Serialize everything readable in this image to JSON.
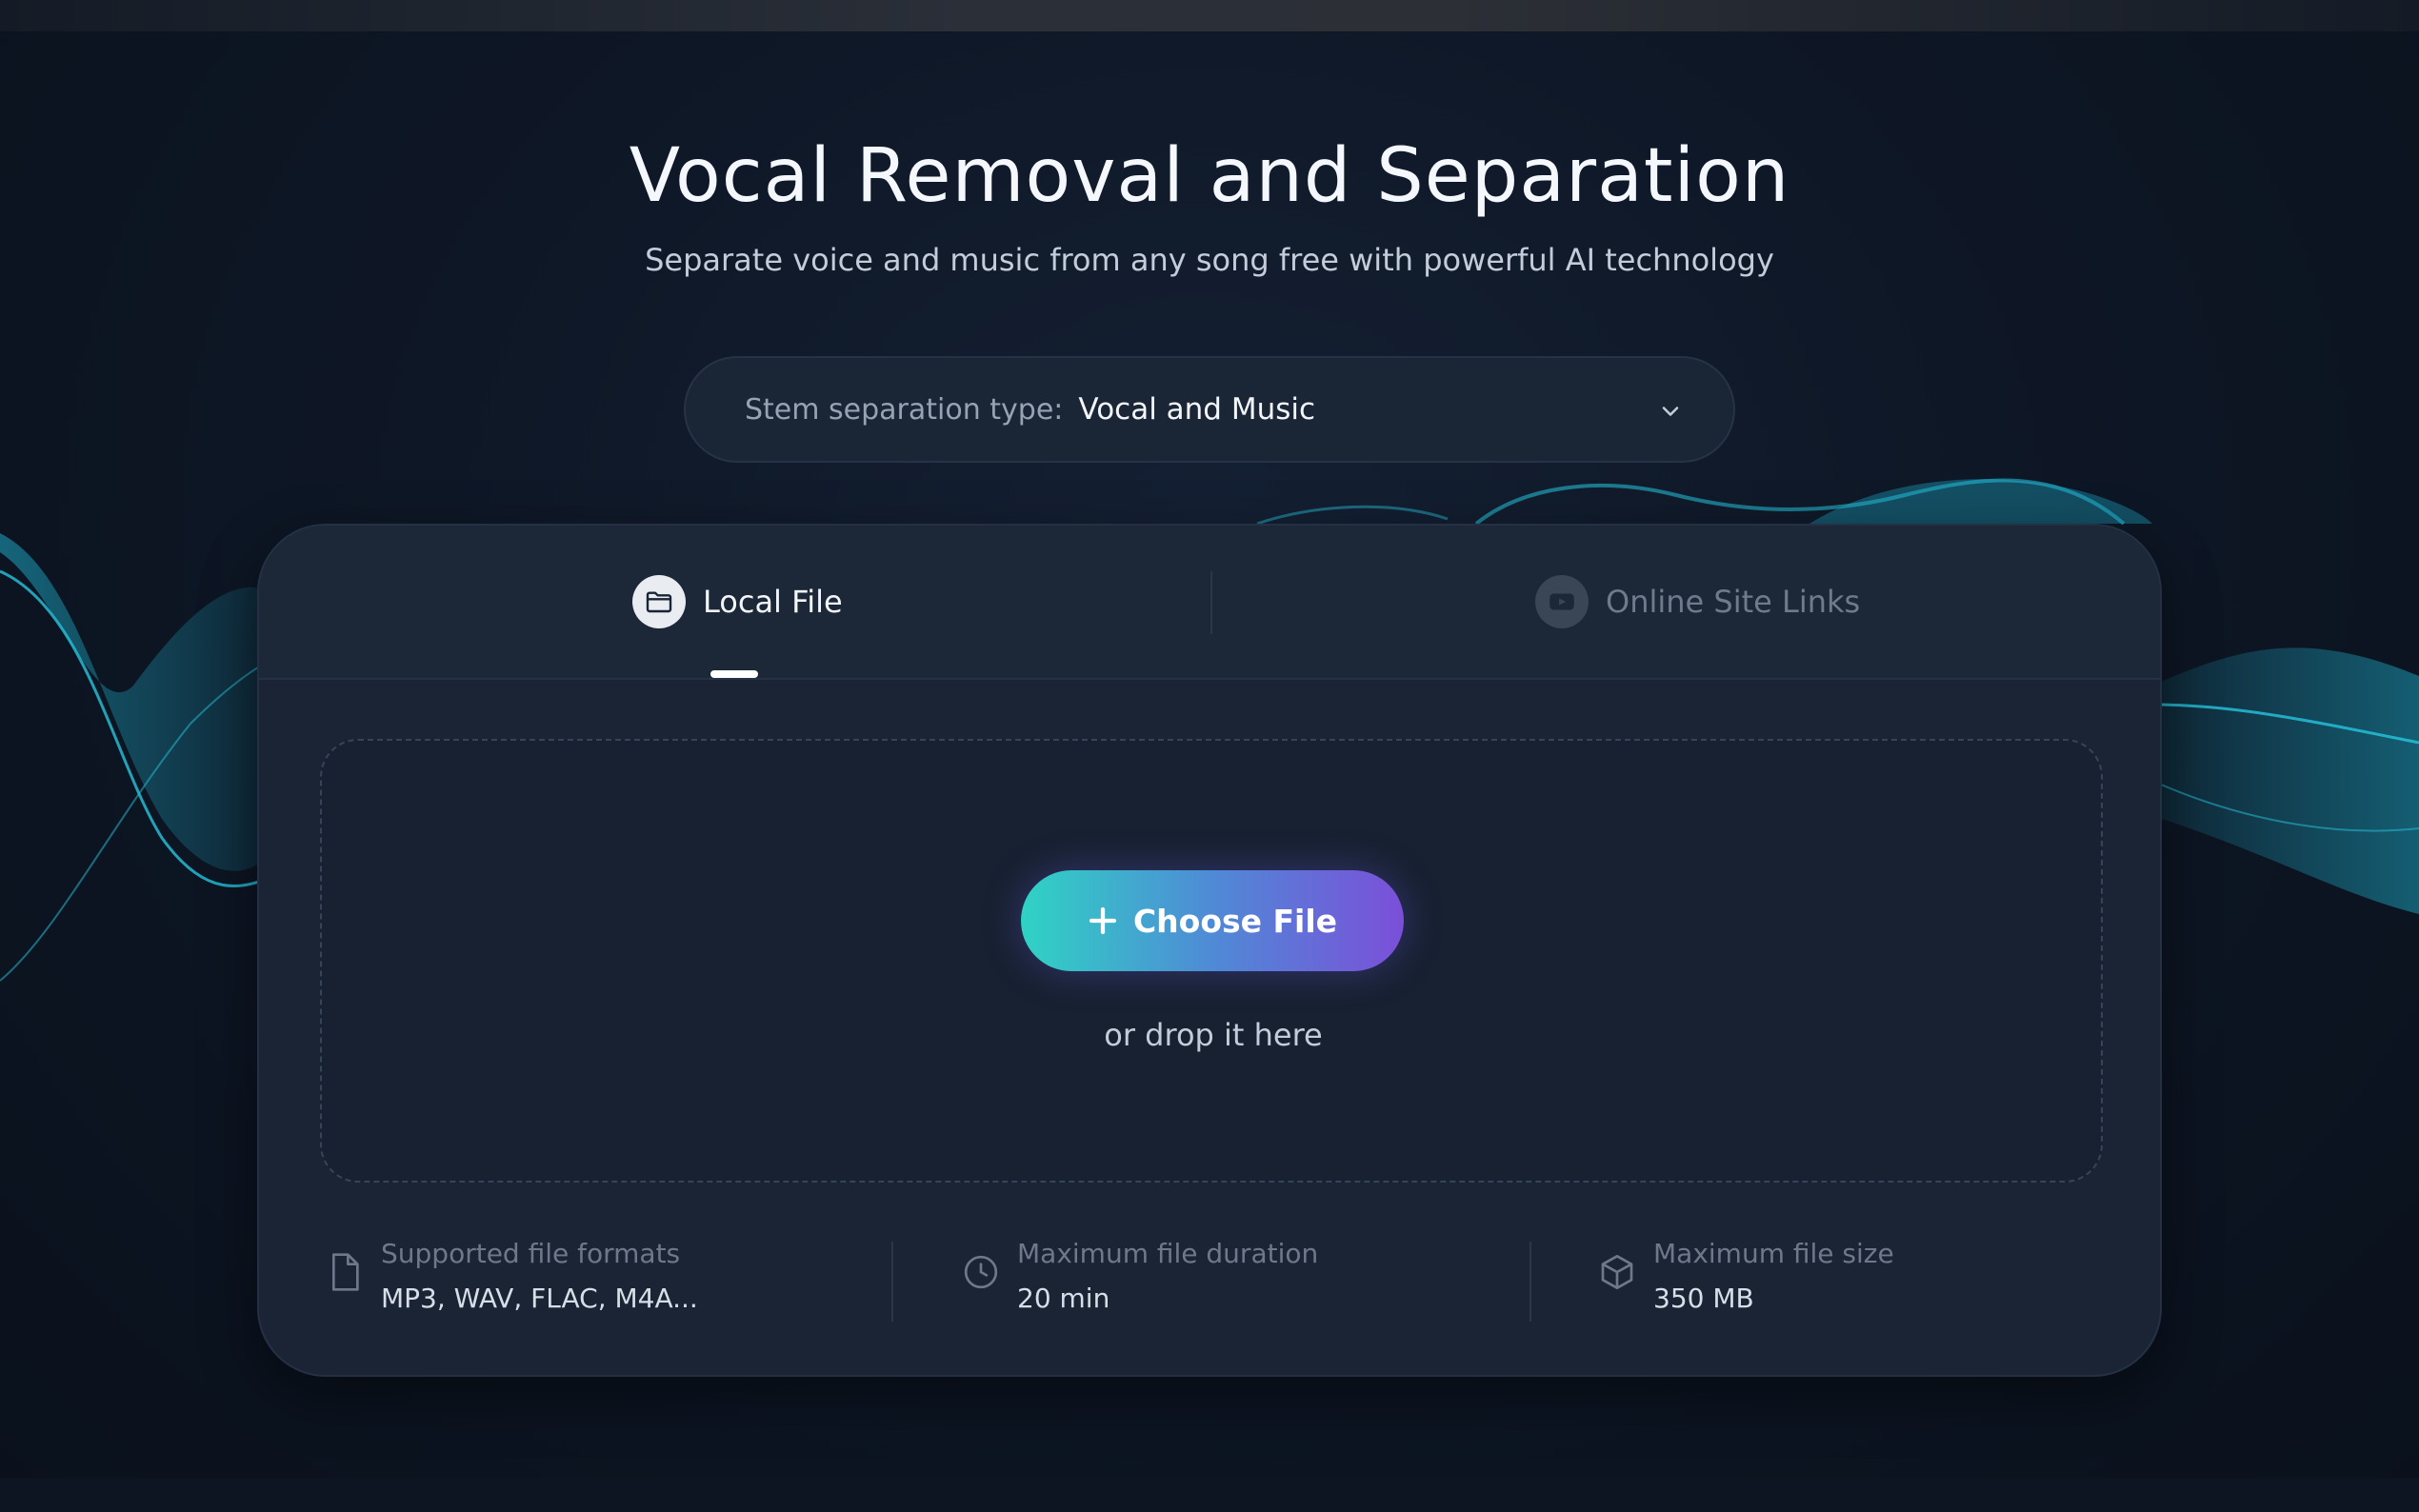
{
  "hero": {
    "title": "Vocal Removal and Separation",
    "subtitle": "Separate voice and music from any song free with powerful AI technology"
  },
  "stem_select": {
    "label": "Stem separation type:",
    "value": "Vocal and Music",
    "icon": "chevron-down-icon"
  },
  "tabs": [
    {
      "label": "Local File",
      "icon": "folder-icon",
      "active": true
    },
    {
      "label": "Online Site Links",
      "icon": "video-play-icon",
      "active": false
    }
  ],
  "upload": {
    "button_label": "Choose File",
    "hint": "or drop it here"
  },
  "info": [
    {
      "label": "Supported file formats",
      "value": "MP3, WAV, FLAC, M4A...",
      "icon": "file-icon"
    },
    {
      "label": "Maximum file duration",
      "value": "20 min",
      "icon": "clock-icon"
    },
    {
      "label": "Maximum file size",
      "value": "350 MB",
      "icon": "box-icon"
    }
  ],
  "colors": {
    "background": "#0c1421",
    "card": "#1a2435",
    "accent_start": "#2fd3c4",
    "accent_end": "#7b4fd9",
    "wave": "#1fb8d6"
  }
}
